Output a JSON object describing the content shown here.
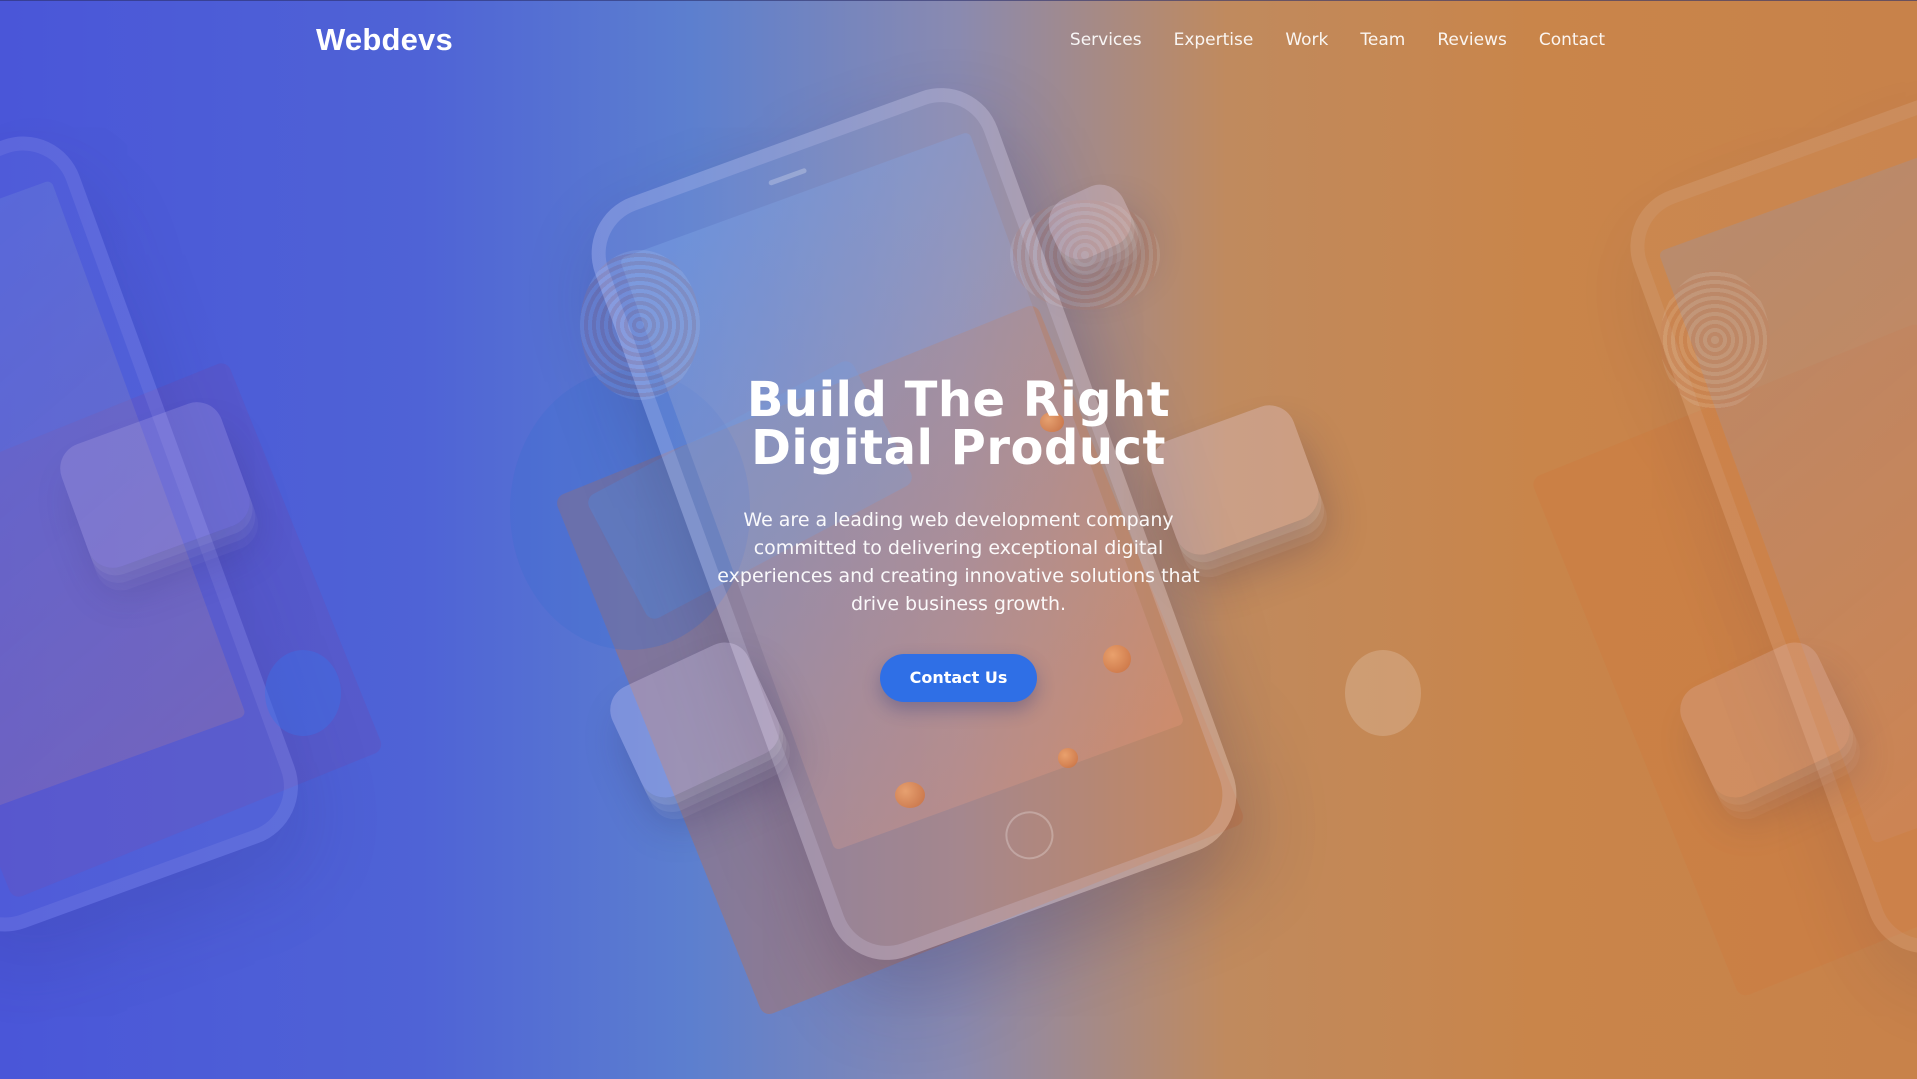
{
  "brand": {
    "name": "Webdevs"
  },
  "nav": {
    "items": [
      {
        "label": "Services"
      },
      {
        "label": "Expertise"
      },
      {
        "label": "Work"
      },
      {
        "label": "Team"
      },
      {
        "label": "Reviews"
      },
      {
        "label": "Contact"
      }
    ]
  },
  "hero": {
    "title_line1": "Build The Right",
    "title_line2": "Digital Product",
    "subtitle": "We are a leading web development company committed to delivering exceptional digital experiences and creating innovative solutions that drive business growth.",
    "cta_label": "Contact Us",
    "background_image": "phone-illustration"
  },
  "colors": {
    "gradient_left": "#4a56d8",
    "gradient_right": "#c8824a",
    "cta": "#2f6fe6",
    "text": "#ffffff"
  }
}
